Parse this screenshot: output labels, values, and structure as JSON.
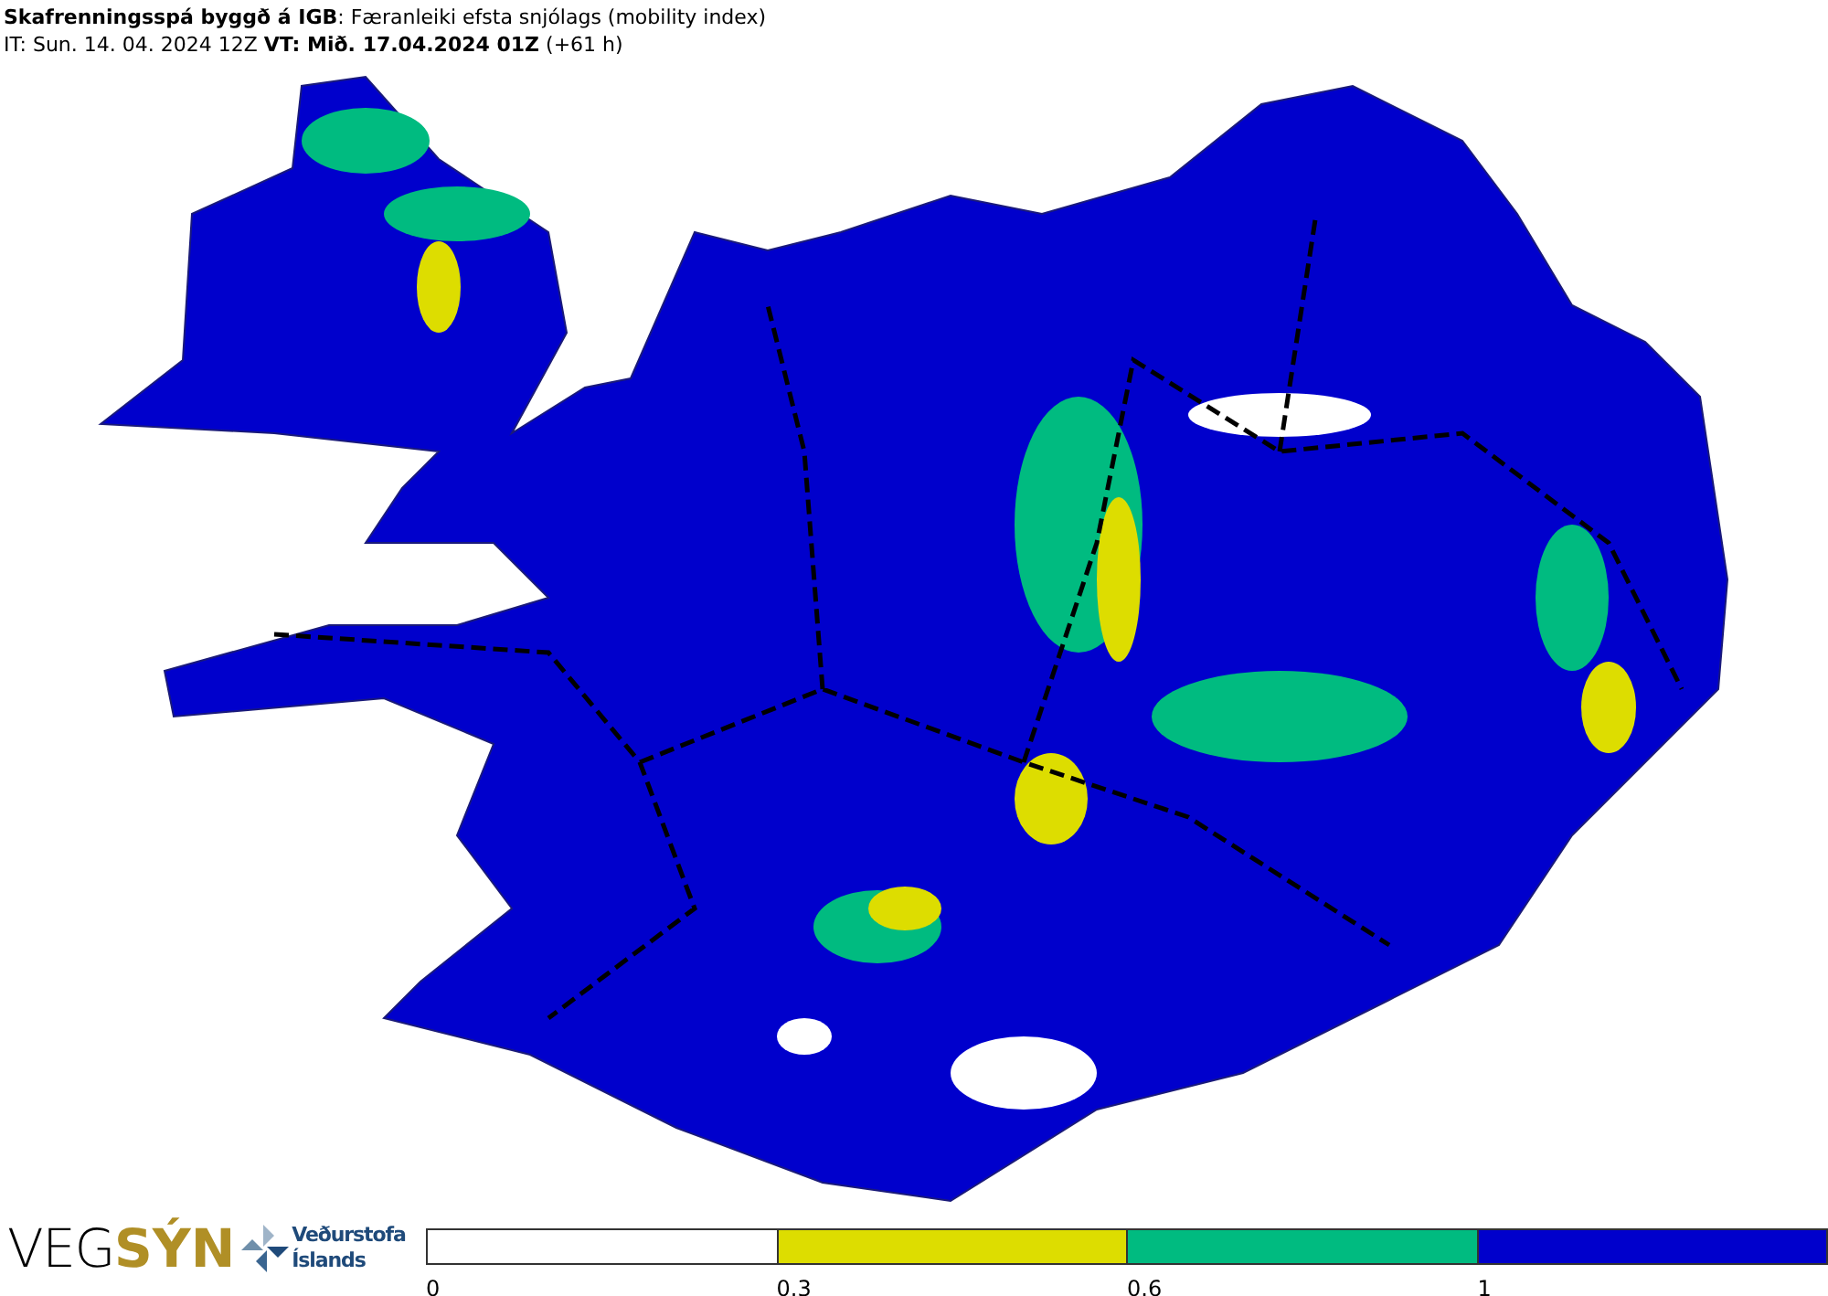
{
  "header": {
    "title": "**Skafrenningsspá byggð á IGB**: Færanleiki efsta snjólags (mobility index)",
    "subtitle": "IT: Sun. 14. 04. 2024 12Z **VT: Mið. 17.04.2024 01Z** (+61 h)"
  },
  "logos": {
    "vegsyn_left": "VEG",
    "vegsyn_right": "SÝN",
    "vedurstofa_line_1": "Veðurstofa",
    "vedurstofa_line_2": "Íslands"
  },
  "legend": {
    "segments": [
      {
        "color": "#ffffff"
      },
      {
        "color": "#dddd00"
      },
      {
        "color": "#00bb80"
      },
      {
        "color": "#0000cc"
      }
    ],
    "ticks": [
      "0",
      "0.3",
      "0.6",
      "1"
    ]
  }
}
